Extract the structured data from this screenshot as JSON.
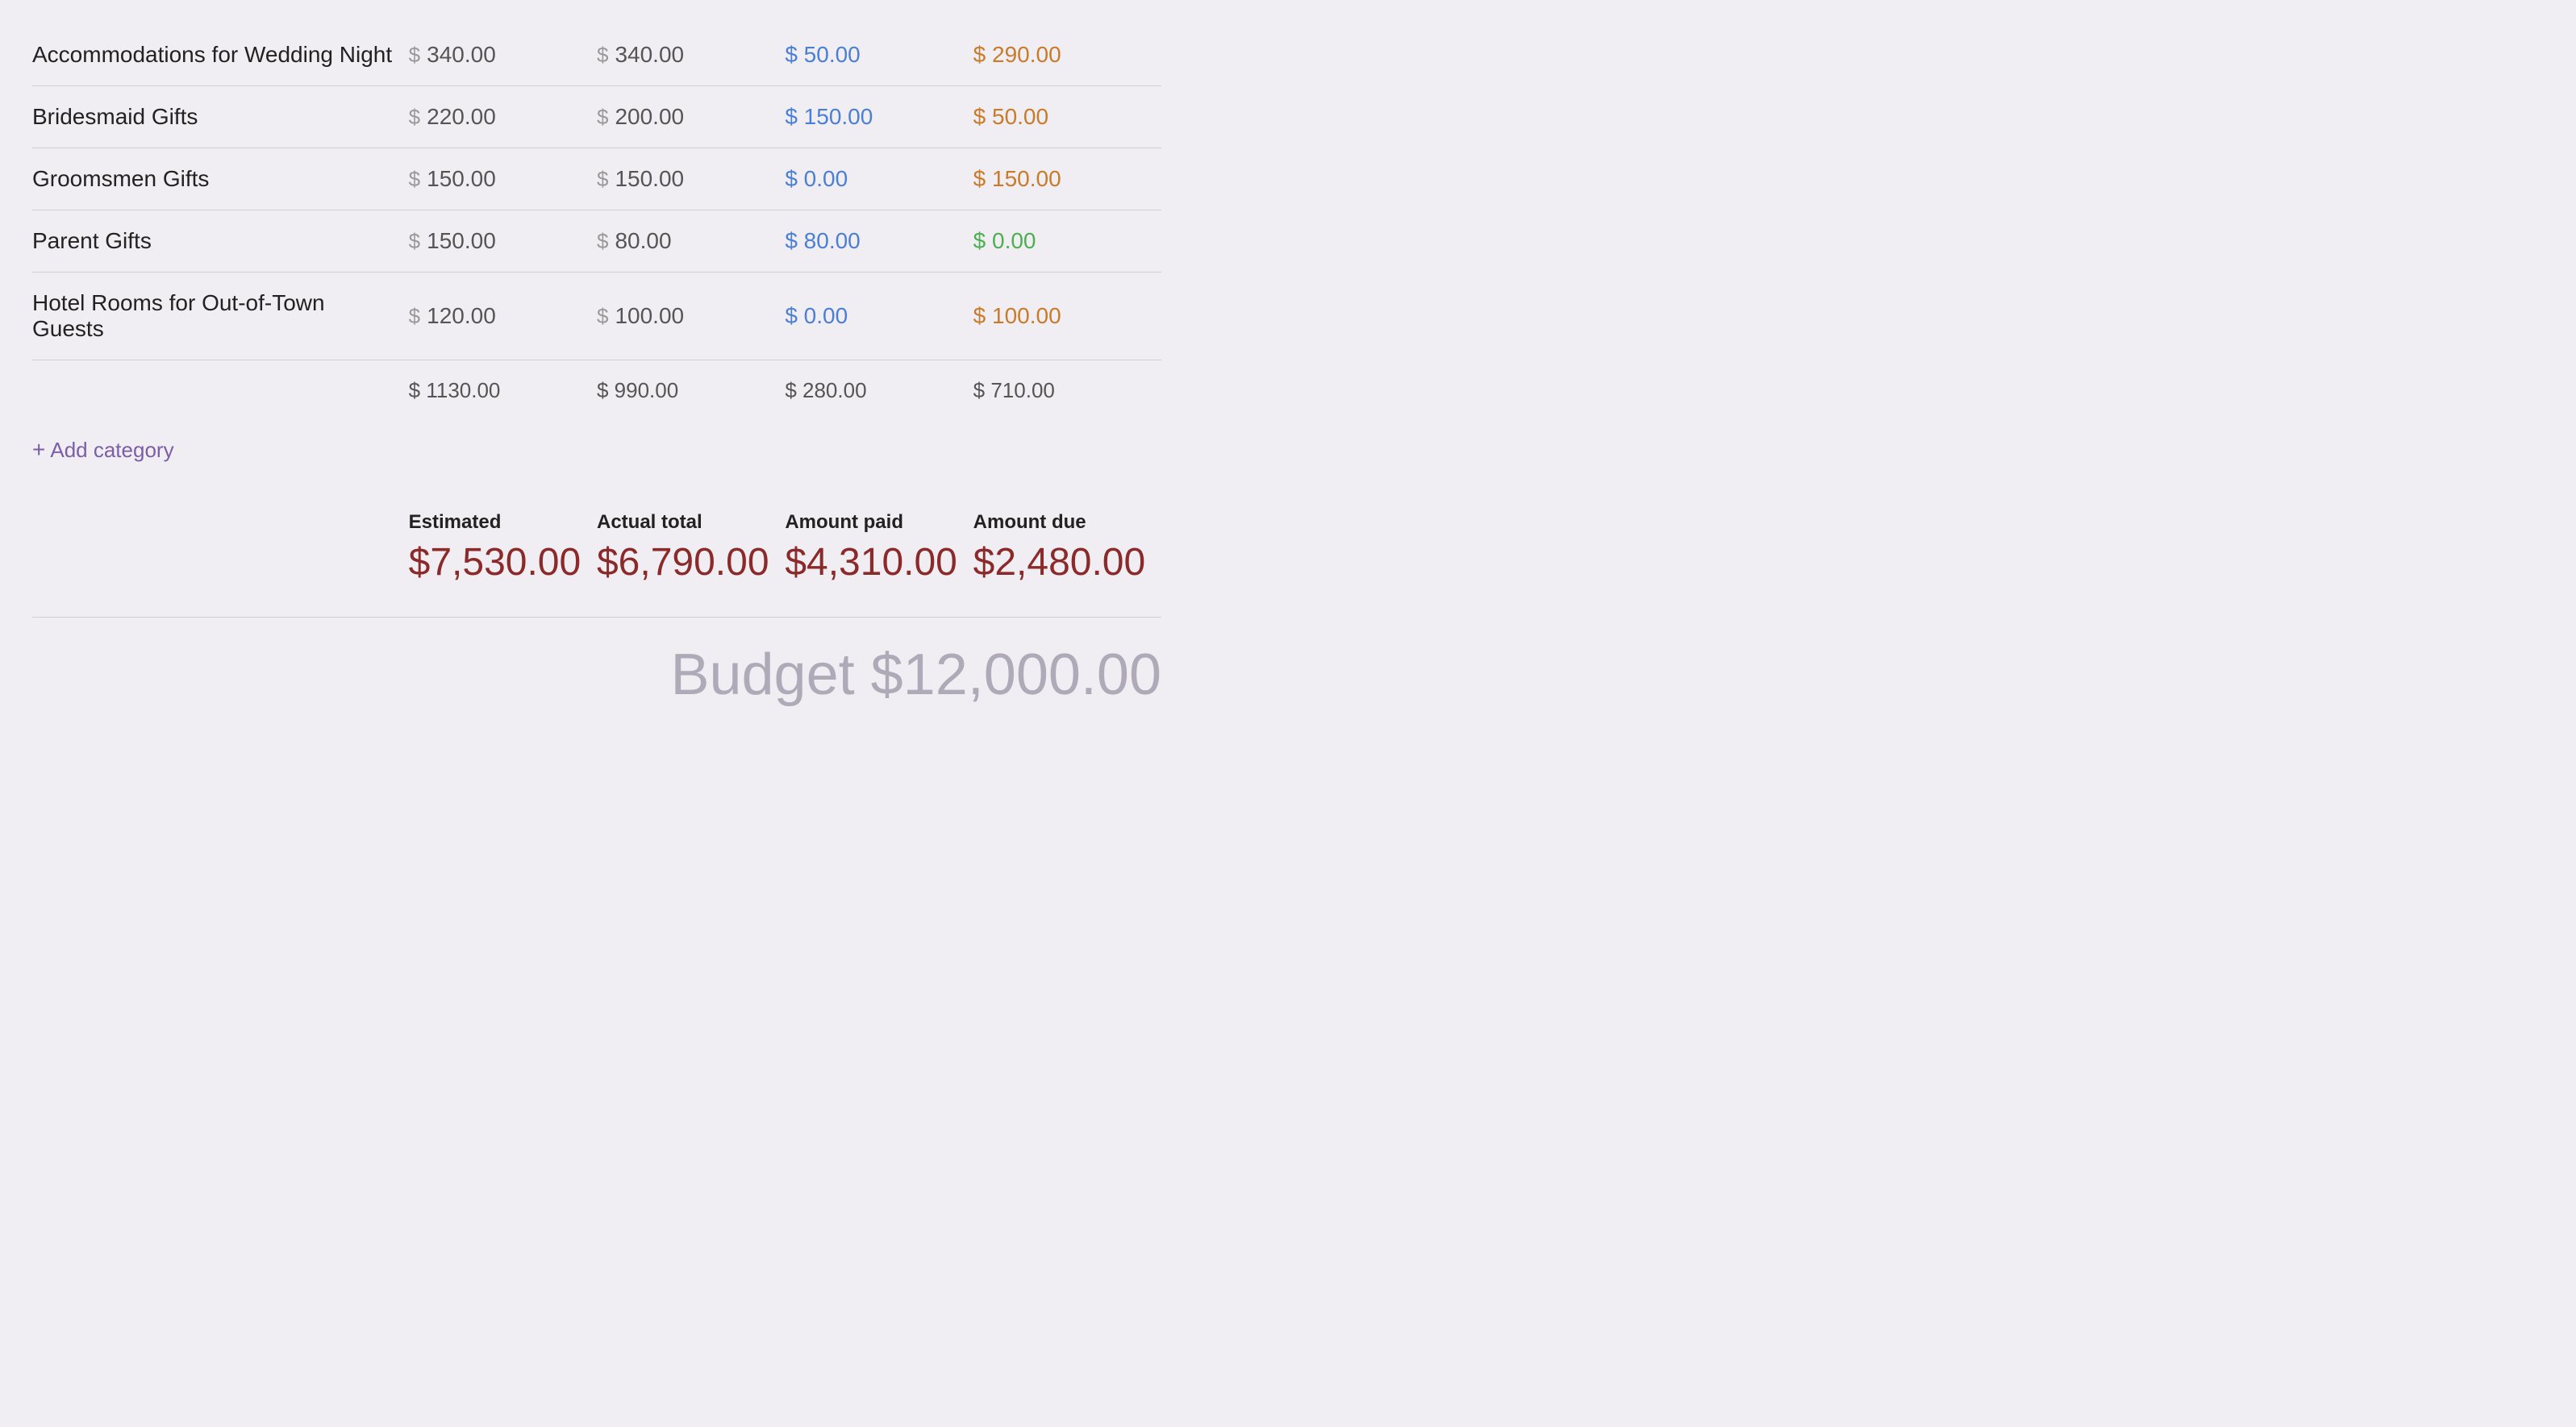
{
  "rows": [
    {
      "name": "Accommodations for Wedding Night",
      "estimated": "340.00",
      "actual": "340.00",
      "paid": "$ 50.00",
      "due": "$ 290.00",
      "due_color": "orange"
    },
    {
      "name": "Bridesmaid Gifts",
      "estimated": "220.00",
      "actual": "200.00",
      "paid": "$ 150.00",
      "due": "$ 50.00",
      "due_color": "orange"
    },
    {
      "name": "Groomsmen Gifts",
      "estimated": "150.00",
      "actual": "150.00",
      "paid": "$ 0.00",
      "due": "$ 150.00",
      "due_color": "orange"
    },
    {
      "name": "Parent Gifts",
      "estimated": "150.00",
      "actual": "80.00",
      "paid": "$ 80.00",
      "due": "$ 0.00",
      "due_color": "green"
    },
    {
      "name": "Hotel Rooms for Out-of-Town Guests",
      "estimated": "120.00",
      "actual": "100.00",
      "paid": "$ 0.00",
      "due": "$ 100.00",
      "due_color": "orange"
    }
  ],
  "totals": {
    "estimated": "$ 1130.00",
    "actual": "$ 990.00",
    "paid": "$ 280.00",
    "due": "$ 710.00"
  },
  "add_category_label": "+ Add category",
  "summary": {
    "estimated_label": "Estimated",
    "estimated_value": "$7,530.00",
    "actual_label": "Actual total",
    "actual_value": "$6,790.00",
    "paid_label": "Amount paid",
    "paid_value": "$4,310.00",
    "due_label": "Amount due",
    "due_value": "$2,480.00"
  },
  "budget_label": "Budget $12,000.00"
}
